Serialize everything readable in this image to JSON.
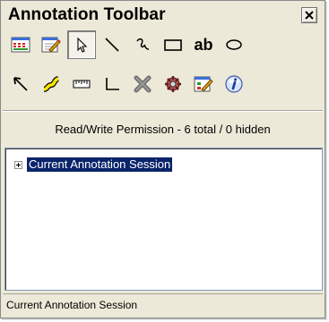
{
  "window": {
    "title": "Annotation Toolbar",
    "close_label": "close"
  },
  "toolbar": {
    "row1": [
      {
        "name": "ruler-grid-icon"
      },
      {
        "name": "edit-note-icon"
      },
      {
        "name": "pointer-select-icon",
        "selected": true
      },
      {
        "name": "line-tool-icon"
      },
      {
        "name": "freehand-tool-icon"
      },
      {
        "name": "rectangle-tool-icon"
      },
      {
        "name": "text-tool-icon",
        "text": "ab"
      },
      {
        "name": "ellipse-tool-icon"
      }
    ],
    "row2": [
      {
        "name": "arrow-tool-icon"
      },
      {
        "name": "highlighter-tool-icon"
      },
      {
        "name": "measure-tool-icon"
      },
      {
        "name": "angle-tool-icon"
      },
      {
        "name": "delete-icon"
      },
      {
        "name": "settings-gear-icon"
      },
      {
        "name": "edit-properties-icon"
      },
      {
        "name": "info-help-icon"
      }
    ]
  },
  "permission": {
    "text": "Read/Write Permission - 6 total / 0 hidden"
  },
  "tree": {
    "items": [
      {
        "label": "Current Annotation Session",
        "selected": true
      }
    ]
  },
  "status": {
    "text": "Current Annotation Session"
  },
  "colors": {
    "window_bg": "#ece9d8",
    "selection": "#0a246a",
    "border": "#7f9db9"
  }
}
